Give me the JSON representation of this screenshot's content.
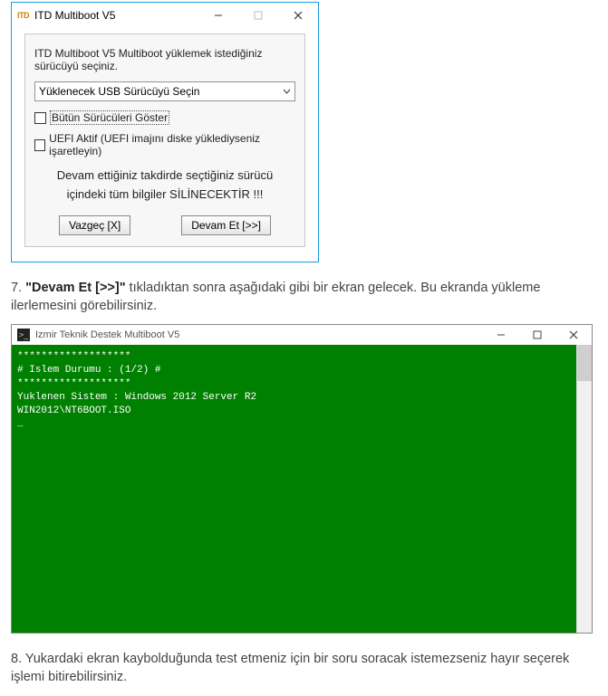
{
  "dialog": {
    "title": "ITD Multiboot V5",
    "icon_text": "ITD",
    "instruction": "ITD Multiboot V5 Multiboot yüklemek istediğiniz sürücüyü seçiniz.",
    "select_placeholder": "Yüklenecek USB Sürücüyü Seçin",
    "checkbox1": "Bütün Sürücüleri Göster",
    "checkbox2": "UEFI Aktif (UEFI imajını diske yüklediyseniz işaretleyin)",
    "warning_line1": "Devam ettiğiniz takdirde seçtiğiniz sürücü",
    "warning_line2": "içindeki tüm bilgiler SİLİNECEKTİR !!!",
    "btn_cancel": "Vazgeç [X]",
    "btn_continue": "Devam Et [>>]"
  },
  "step7": {
    "num": "7. ",
    "bold": "\"Devam Et [>>]\"",
    "rest": " tıkladıktan sonra aşağıdaki gibi bir ekran gelecek. Bu ekranda yükleme ilerlemesini görebilirsiniz."
  },
  "console": {
    "title": "Izmir Teknik Destek Multiboot V5",
    "line1": "*******************",
    "line2": "# Islem Durumu : (1/2) #",
    "line3": "*******************",
    "line4": "Yuklenen Sistem : Windows 2012 Server R2",
    "line5": "WIN2012\\NT6BOOT.ISO",
    "cursor": "_"
  },
  "step8": {
    "text": "8. Yukardaki ekran kaybolduğunda test etmeniz için bir soru soracak istemezseniz hayır seçerek işlemi bitirebilirsiniz."
  }
}
